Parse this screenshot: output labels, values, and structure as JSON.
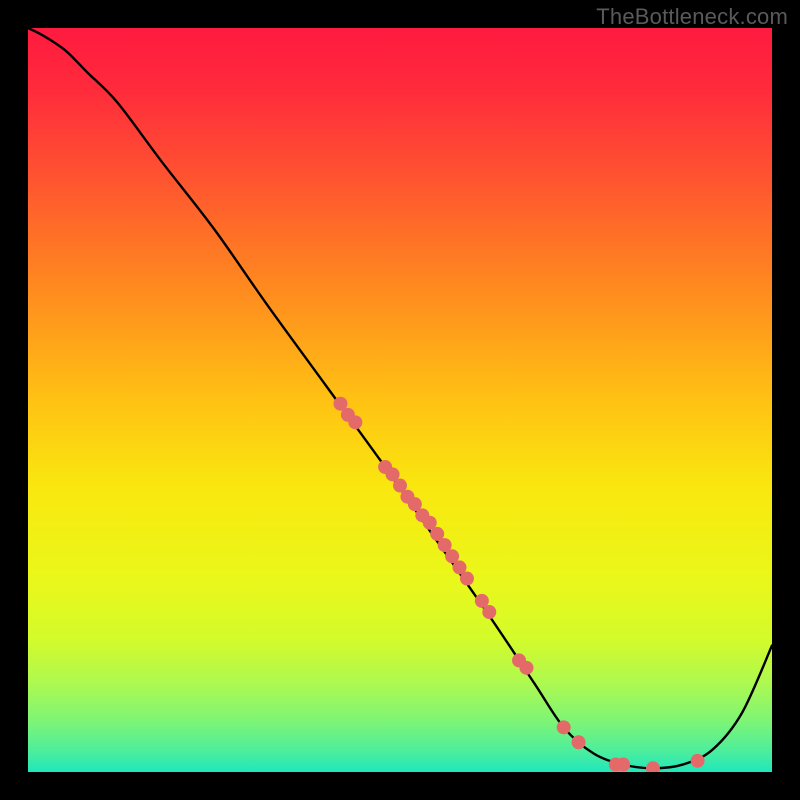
{
  "watermark": "TheBottleneck.com",
  "chart_data": {
    "type": "line",
    "title": "",
    "xlabel": "",
    "ylabel": "",
    "xlim": [
      0,
      100
    ],
    "ylim": [
      0,
      100
    ],
    "grid": false,
    "background": "rainbow-vertical-gradient",
    "series": [
      {
        "name": "curve",
        "x": [
          0,
          2,
          5,
          8,
          12,
          18,
          25,
          32,
          40,
          48,
          55,
          62,
          68,
          72,
          76,
          80,
          84,
          88,
          92,
          96,
          100
        ],
        "y": [
          100,
          99,
          97,
          94,
          90,
          82,
          73,
          63,
          52,
          41,
          31,
          21,
          12,
          6,
          2.5,
          1,
          0.5,
          1,
          3,
          8,
          17
        ]
      }
    ],
    "points": {
      "name": "dots",
      "color": "#e46a6a",
      "radius": 7,
      "x": [
        42,
        43,
        44,
        48,
        49,
        50,
        51,
        52,
        53,
        54,
        55,
        56,
        57,
        58,
        59,
        61,
        62,
        66,
        67,
        72,
        74,
        79,
        80,
        84,
        90
      ],
      "y": [
        49.5,
        48,
        47,
        41,
        40,
        38.5,
        37,
        36,
        34.5,
        33.5,
        32,
        30.5,
        29,
        27.5,
        26,
        23,
        21.5,
        15,
        14,
        6,
        4,
        1,
        1,
        0.5,
        1.5
      ]
    }
  }
}
